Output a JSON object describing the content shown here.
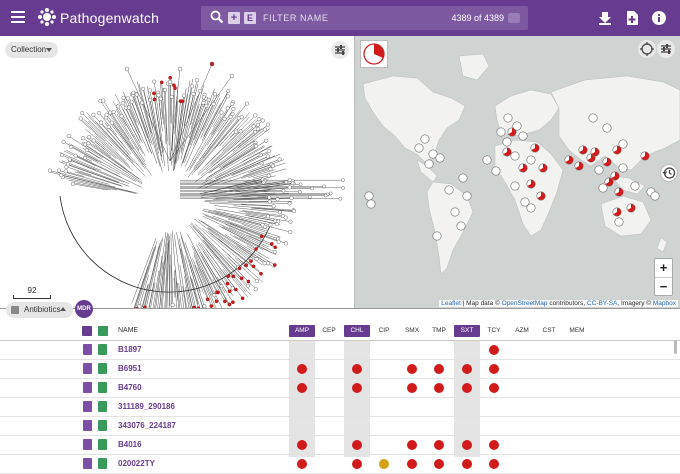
{
  "app": {
    "brand": "Pathogenwatch",
    "filter_placeholder": "FILTER NAME",
    "count": "4389 of 4389",
    "plus_label": "+",
    "e_label": "E"
  },
  "tree": {
    "collection_label": "Collection",
    "scale_value": "92"
  },
  "map": {
    "zoom_in": "+",
    "zoom_out": "−",
    "attribution": {
      "leaflet": "Leaflet",
      "mapdata": " | Map data © ",
      "osm": "OpenStreetMap",
      "contributors": " contributors, ",
      "ccbysa": "CC-BY-SA",
      "imagery": ", Imagery © ",
      "mapbox": "Mapbox"
    }
  },
  "table": {
    "antibiotics_label": "Antibiotics",
    "mdr_label": "MDR",
    "name_header": "NAME",
    "antibiotics": [
      {
        "code": "AMP",
        "selected": true
      },
      {
        "code": "CEP",
        "selected": false
      },
      {
        "code": "CHL",
        "selected": true
      },
      {
        "code": "CIP",
        "selected": false
      },
      {
        "code": "SMX",
        "selected": false
      },
      {
        "code": "TMP",
        "selected": false
      },
      {
        "code": "SXT",
        "selected": true
      },
      {
        "code": "TCY",
        "selected": false
      },
      {
        "code": "AZM",
        "selected": false
      },
      {
        "code": "CST",
        "selected": false
      },
      {
        "code": "MEM",
        "selected": false
      }
    ],
    "rows": [
      {
        "name": "B1897",
        "marks": [
          "",
          "",
          "",
          "",
          "",
          "",
          "",
          "R",
          "",
          "",
          ""
        ]
      },
      {
        "name": "B6951",
        "marks": [
          "R",
          "",
          "R",
          "",
          "R",
          "R",
          "R",
          "R",
          "",
          "",
          ""
        ]
      },
      {
        "name": "B4760",
        "marks": [
          "R",
          "",
          "R",
          "",
          "R",
          "R",
          "R",
          "R",
          "",
          "",
          ""
        ]
      },
      {
        "name": "311189_290186",
        "marks": [
          "",
          "",
          "",
          "",
          "",
          "",
          "",
          "",
          "",
          "",
          ""
        ]
      },
      {
        "name": "343076_224187",
        "marks": [
          "",
          "",
          "",
          "",
          "",
          "",
          "",
          "",
          "",
          "",
          ""
        ]
      },
      {
        "name": "B4016",
        "marks": [
          "R",
          "",
          "R",
          "",
          "R",
          "R",
          "R",
          "R",
          "",
          "",
          ""
        ]
      },
      {
        "name": "020022TY",
        "marks": [
          "R",
          "",
          "R",
          "I",
          "R",
          "R",
          "R",
          "R",
          "",
          "",
          ""
        ]
      }
    ]
  },
  "colors": {
    "brand_purple": "#673c90",
    "resistant_red": "#d11a1a",
    "intermediate_amber": "#d4a017",
    "map_land": "#f2f2f0",
    "map_water": "#cfd3d2"
  }
}
